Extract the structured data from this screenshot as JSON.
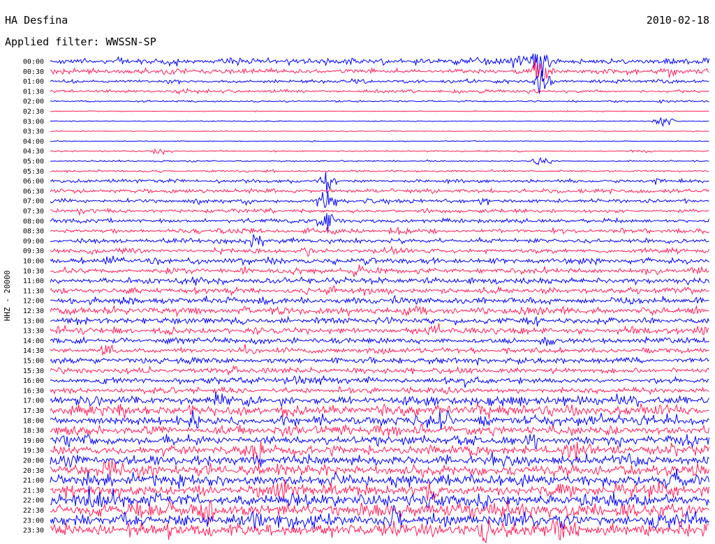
{
  "header": {
    "station": "HA Desfina",
    "date": "2010-02-18",
    "filter_label": "Applied filter: WWSSN-SP"
  },
  "axis": {
    "channel_label": "HHZ - 20000"
  },
  "chart_data": {
    "type": "line",
    "title": "HA Desfina",
    "date": "2010-02-18",
    "filter": "WWSSN-SP",
    "ylabel": "HHZ - 20000",
    "row_labels": [
      "00:00",
      "00:30",
      "01:00",
      "01:30",
      "02:00",
      "02:30",
      "03:00",
      "03:30",
      "04:00",
      "04:30",
      "05:00",
      "05:30",
      "06:00",
      "06:30",
      "07:00",
      "07:30",
      "08:00",
      "08:30",
      "09:00",
      "09:30",
      "10:00",
      "10:30",
      "11:00",
      "11:30",
      "12:00",
      "12:30",
      "13:00",
      "13:30",
      "14:00",
      "14:30",
      "15:00",
      "15:30",
      "16:00",
      "16:30",
      "17:00",
      "17:30",
      "18:00",
      "18:30",
      "19:00",
      "19:30",
      "20:00",
      "20:30",
      "21:00",
      "21:30",
      "22:00",
      "22:30",
      "23:00",
      "23:30"
    ],
    "row_colors": [
      "#0000ff",
      "#ff1f5a"
    ],
    "row_activity": [
      2.6,
      2.2,
      1.5,
      1.3,
      0.7,
      0.4,
      0.4,
      0.4,
      0.35,
      0.55,
      0.6,
      0.8,
      1.3,
      1.7,
      1.6,
      1.6,
      1.8,
      1.9,
      2.0,
      2.2,
      2.6,
      2.6,
      2.7,
      2.8,
      3.0,
      3.0,
      2.9,
      2.8,
      2.4,
      2.3,
      2.6,
      2.7,
      2.6,
      2.4,
      4.2,
      4.5,
      4.3,
      4.2,
      4.0,
      4.2,
      4.6,
      4.8,
      5.2,
      5.6,
      5.8,
      5.9,
      6.0,
      6.1
    ],
    "events": [
      {
        "row": 0,
        "x": 0.745,
        "amplitude": 8
      },
      {
        "row": 1,
        "x": 0.745,
        "amplitude": 5
      },
      {
        "row": 2,
        "x": 0.745,
        "amplitude": 4
      },
      {
        "row": 6,
        "x": 0.93,
        "amplitude": 2
      },
      {
        "row": 9,
        "x": 0.17,
        "amplitude": 1.5
      },
      {
        "row": 10,
        "x": 0.745,
        "amplitude": 2
      },
      {
        "row": 12,
        "x": 0.42,
        "amplitude": 3
      },
      {
        "row": 14,
        "x": 0.42,
        "amplitude": 5
      },
      {
        "row": 16,
        "x": 0.42,
        "amplitude": 4
      }
    ],
    "grid": false,
    "legend": "none"
  }
}
